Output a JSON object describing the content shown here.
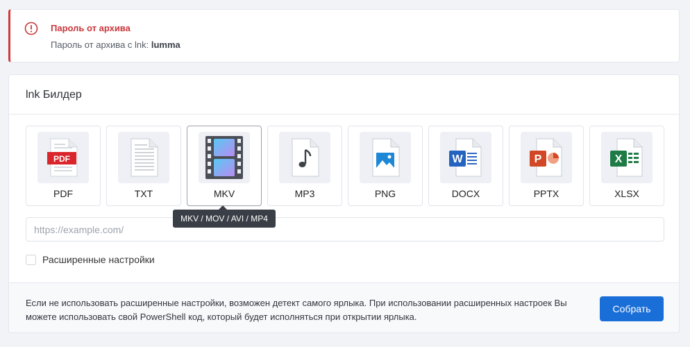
{
  "alert": {
    "title": "Пароль от архива",
    "text_prefix": "Пароль от архива с lnk: ",
    "password": "lumma",
    "icon": "exclamation-circle-icon",
    "color": "#d0393d"
  },
  "builder": {
    "title": "lnk Билдер",
    "formats": [
      {
        "label": "PDF",
        "icon": "pdf-file-icon"
      },
      {
        "label": "TXT",
        "icon": "text-file-icon"
      },
      {
        "label": "MKV",
        "icon": "film-strip-icon"
      },
      {
        "label": "MP3",
        "icon": "music-note-file-icon"
      },
      {
        "label": "PNG",
        "icon": "image-file-icon"
      },
      {
        "label": "DOCX",
        "icon": "word-file-icon"
      },
      {
        "label": "PPTX",
        "icon": "powerpoint-file-icon"
      },
      {
        "label": "XLSX",
        "icon": "excel-file-icon"
      }
    ],
    "selected_format": "MKV",
    "tooltip": "MKV / MOV / AVI / MP4",
    "url_input": {
      "value": "",
      "placeholder": "https://example.com/"
    },
    "advanced_settings_label": "Расширенные настройки",
    "advanced_settings_checked": false,
    "note": "Если не использовать расширенные настройки, возможен детект самого ярлыка. При использовании расширенных настроек Вы можете использовать свой PowerShell код, который будет исполняться при открытии ярлыка.",
    "build_button_label": "Собрать",
    "accent_color": "#1a6ed8"
  }
}
